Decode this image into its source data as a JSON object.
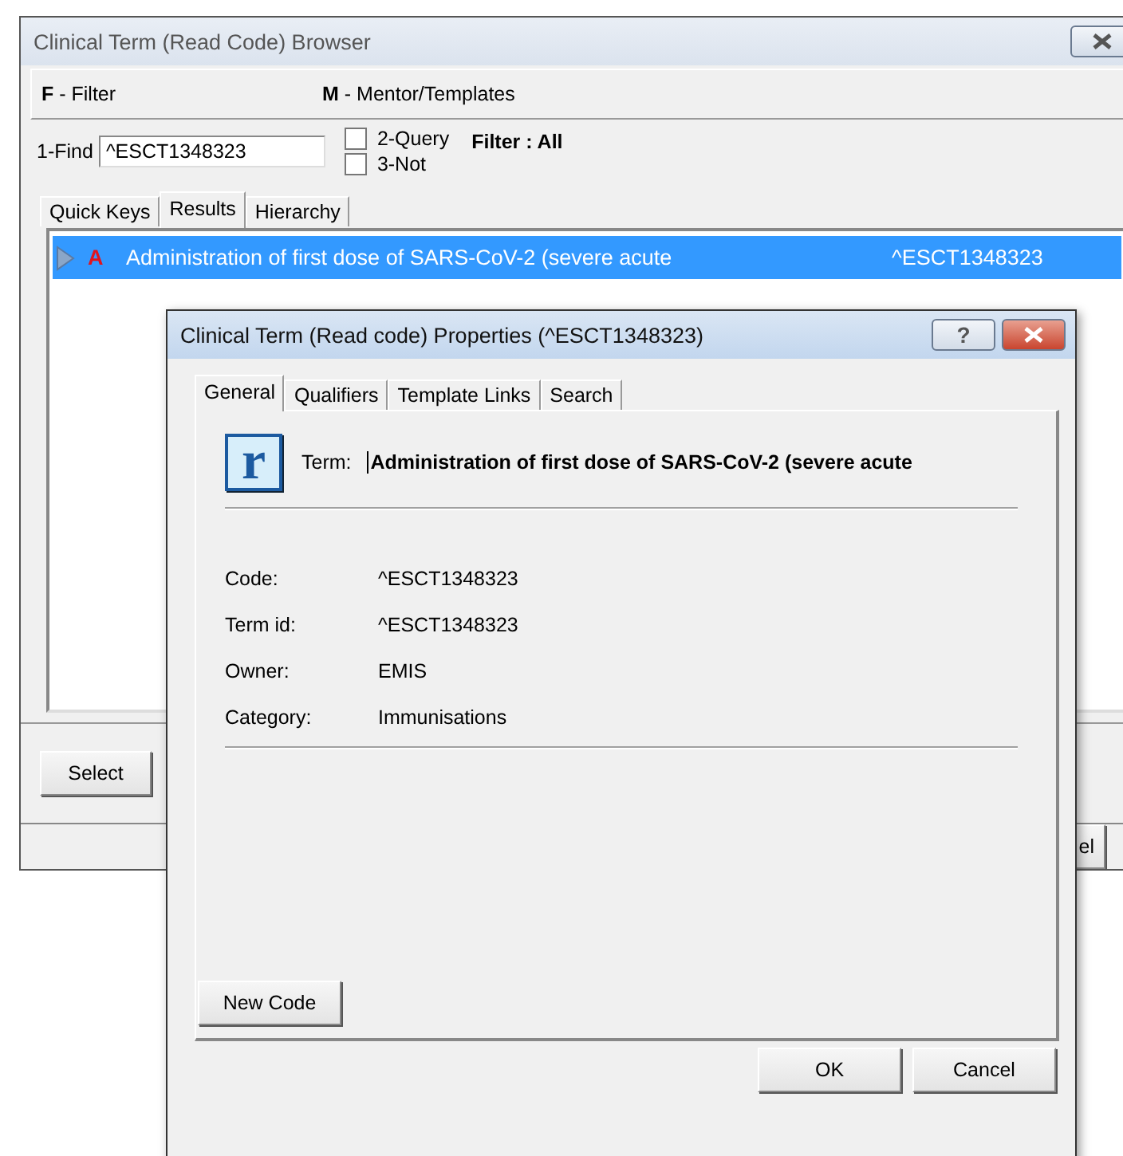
{
  "browser": {
    "title": "Clinical Term (Read Code) Browser",
    "menu": [
      "**F** - Filter",
      "**M** - Mentor/Templates"
    ],
    "find": {
      "label": "1-Find",
      "value": "^ESCT1348323"
    },
    "options": [
      {
        "label": "2-Query",
        "checked": false
      },
      {
        "label": "3-Not",
        "checked": false
      }
    ],
    "filter": "Filter : All",
    "tabs": [
      {
        "label": "Quick Keys",
        "selected": false
      },
      {
        "label": "Results",
        "selected": true
      },
      {
        "label": "Hierarchy",
        "selected": false
      }
    ],
    "results": [
      {
        "flag": "A",
        "term": "Administration of first dose of SARS-CoV-2 (severe acute",
        "code": "^ESCT1348323",
        "selected": true
      }
    ],
    "select_button": "Select",
    "cut_button": "el"
  },
  "properties": {
    "title": "Clinical Term (Read code) Properties (^ESCT1348323)",
    "help": "?",
    "tabs": [
      {
        "label": "General",
        "selected": true
      },
      {
        "label": "Qualifiers",
        "selected": false
      },
      {
        "label": "Template Links",
        "selected": false
      },
      {
        "label": "Search",
        "selected": false
      }
    ],
    "logo": "r",
    "term_label": "Term:",
    "term": "Administration of first dose of SARS-CoV-2 (severe acute",
    "fields": [
      {
        "label": "Code:",
        "value": "^ESCT1348323"
      },
      {
        "label": "Term id:",
        "value": "^ESCT1348323"
      },
      {
        "label": "Owner:",
        "value": "EMIS"
      },
      {
        "label": "Category:",
        "value": "Immunisations"
      }
    ],
    "new_code": "New Code",
    "buttons": [
      "OK",
      "Cancel"
    ]
  }
}
